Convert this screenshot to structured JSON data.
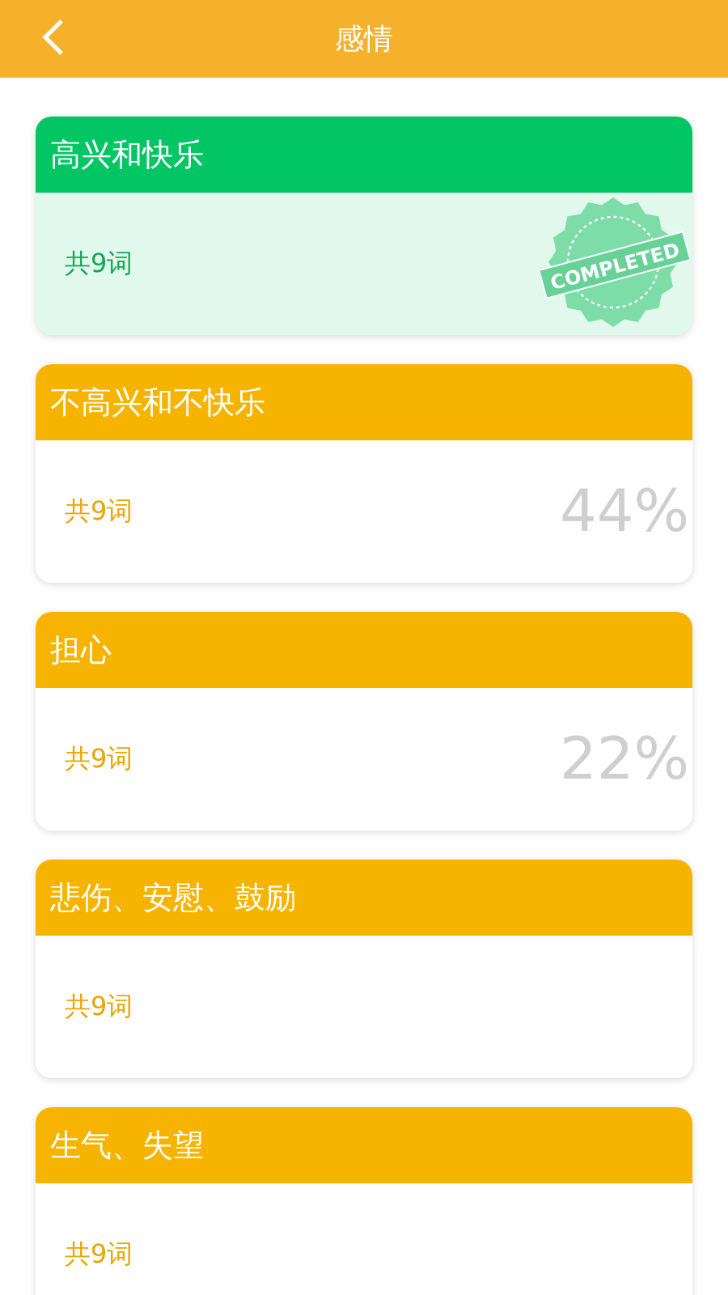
{
  "header": {
    "title": "感情"
  },
  "lessons": [
    {
      "title": "高兴和快乐",
      "count": "共9词",
      "completed": true,
      "stamp": "COMPLETED"
    },
    {
      "title": "不高兴和不快乐",
      "count": "共9词",
      "completed": false,
      "progress": "44%"
    },
    {
      "title": "担心",
      "count": "共9词",
      "completed": false,
      "progress": "22%"
    },
    {
      "title": "悲伤、安慰、鼓励",
      "count": "共9词",
      "completed": false
    },
    {
      "title": "生气、失望",
      "count": "共9词",
      "completed": false
    }
  ]
}
